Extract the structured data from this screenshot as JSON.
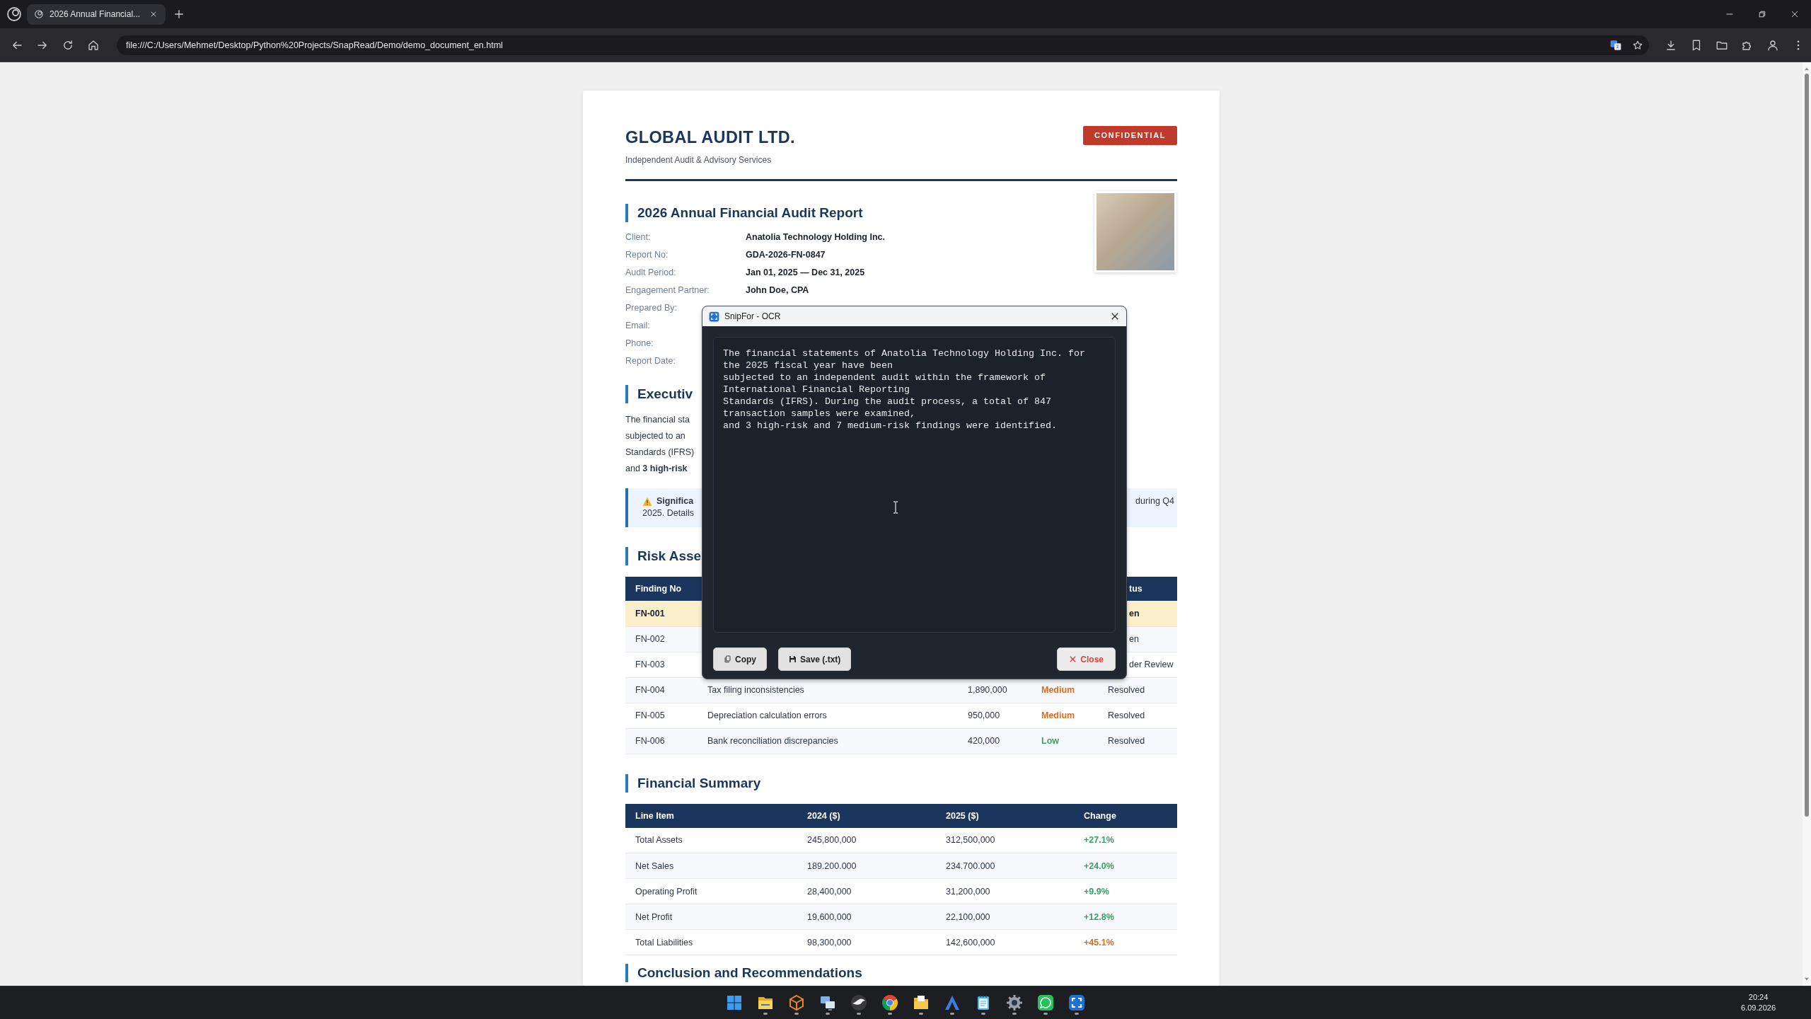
{
  "browser": {
    "tab_title": "2026 Annual Financial...",
    "url": "file:///C:/Users/Mehmet/Desktop/Python%20Projects/SnapRead/Demo/demo_document_en.html"
  },
  "document": {
    "company": "GLOBAL AUDIT LTD.",
    "tagline": "Independent Audit & Advisory Services",
    "badge": "CONFIDENTIAL",
    "report_title": "2026 Annual Financial Audit Report",
    "details": [
      {
        "label": "Client:",
        "value": "Anatolia Technology Holding Inc."
      },
      {
        "label": "Report No:",
        "value": "GDA-2026-FN-0847"
      },
      {
        "label": "Audit Period:",
        "value": "Jan 01, 2025 — Dec 31, 2025"
      },
      {
        "label": "Engagement Partner:",
        "value": "John Doe, CPA"
      },
      {
        "label": "Prepared By:"
      },
      {
        "label": "Email:"
      },
      {
        "label": "Phone:"
      },
      {
        "label": "Report Date:"
      }
    ],
    "executive_summary": {
      "title": "Executiv",
      "lines": [
        "The financial sta",
        "subjected to an",
        "Standards (IFRS)",
        "and **3 high-risk**"
      ]
    },
    "alert": {
      "title": "Significa",
      "line_1_end": "during Q4",
      "line_2": "2025. Details"
    },
    "risk_assessment": {
      "title": "Risk Asse",
      "columns": {
        "column_1": "Finding No",
        "column_5": "tus"
      },
      "rows": [
        {
          "highlighted": true,
          "column_1": "FN-001",
          "column_5": "en"
        },
        {
          "highlighted": false,
          "column_1": "FN-002",
          "column_5": "en"
        },
        {
          "highlighted": false,
          "column_1": "FN-003",
          "column_5": "der Review"
        },
        {
          "highlighted": false,
          "column_1": "FN-004",
          "column_2": "Tax filing inconsistencies",
          "column_3": "1,890,000",
          "column_4": {
            "text": "Medium",
            "color": "#dd6b20"
          },
          "column_5": "Resolved"
        },
        {
          "highlighted": false,
          "column_1": "FN-005",
          "column_2": "Depreciation calculation errors",
          "column_3": "950,000",
          "column_4": {
            "text": "Medium",
            "color": "#dd6b20"
          },
          "column_5": "Resolved"
        },
        {
          "highlighted": false,
          "column_1": "FN-006",
          "column_2": "Bank reconciliation discrepancies",
          "column_3": "420,000",
          "column_4": {
            "text": "Low",
            "color": "#38a169"
          },
          "column_5": "Resolved"
        }
      ]
    },
    "financial_summary": {
      "title": "Financial Summary",
      "columns": [
        "Line Item",
        "2024 ($)",
        "2025 ($)",
        "Change"
      ],
      "rows": [
        {
          "line_item": "Total Assets",
          "y2024": "245,800,000",
          "y2025": "312,500,000",
          "change": {
            "text": "+27.1%",
            "color": "#38a169"
          }
        },
        {
          "line_item": "Net Sales",
          "y2024": "189.200.000",
          "y2025": "234.700.000",
          "change": {
            "text": "+24.0%",
            "color": "#38a169"
          }
        },
        {
          "line_item": "Operating Profit",
          "y2024": "28,400,000",
          "y2025": "31,200,000",
          "change": {
            "text": "+9.9%",
            "color": "#38a169"
          }
        },
        {
          "line_item": "Net Profit",
          "y2024": "19,600,000",
          "y2025": "22,100,000",
          "change": {
            "text": "+12.8%",
            "color": "#38a169"
          }
        },
        {
          "line_item": "Total Liabilities",
          "y2024": "98,300,000",
          "y2025": "142,600,000",
          "change": {
            "text": "+45.1%",
            "color": "#dd6b20"
          }
        }
      ]
    },
    "conclusion": {
      "title": "Conclusion and Recommendations"
    }
  },
  "ocr_dialog": {
    "title": "SnipFor - OCR",
    "text": "The financial statements of Anatolia Technology Holding Inc. for the 2025 fiscal year have been\nsubjected to an independent audit within the framework of International Financial Reporting\nStandards (IFRS). During the audit process, a total of 847 transaction samples were examined,\nand 3 high-risk and 7 medium-risk findings were identified.",
    "buttons": [
      {
        "kind": "copy",
        "label": "Copy"
      },
      {
        "kind": "save",
        "label": "Save (.txt)"
      },
      {
        "kind": "close",
        "label": "Close"
      }
    ]
  },
  "taskbar": {
    "apps": [
      {
        "kind": "start",
        "open": false
      },
      {
        "kind": "files",
        "open": true
      },
      {
        "kind": "cube",
        "open": true
      },
      {
        "kind": "computers",
        "open": true
      },
      {
        "kind": "bird",
        "open": true
      },
      {
        "kind": "browser",
        "open": true
      },
      {
        "kind": "drive_folder",
        "open": true
      },
      {
        "kind": "triangle",
        "open": true
      },
      {
        "kind": "notepad",
        "open": true
      },
      {
        "kind": "settings",
        "open": true
      },
      {
        "kind": "chat",
        "open": true
      },
      {
        "kind": "app_logo",
        "open": true
      }
    ],
    "clock": {
      "time": "20:24",
      "date": "6.09.2026"
    }
  }
}
